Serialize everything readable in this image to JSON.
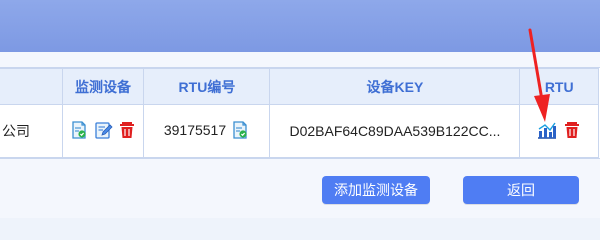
{
  "table": {
    "headers": {
      "monitor_device": "监测设备",
      "rtu_code": "RTU编号",
      "device_key": "设备KEY",
      "rtu": "RTU"
    },
    "row": {
      "company_fragment": "公司",
      "rtu_code": "39175517",
      "device_key": "D02BAF64C89DAA539B122CC..."
    }
  },
  "buttons": {
    "add_device": "添加监测设备",
    "back": "返回"
  },
  "colors": {
    "header_bar": "#7d99e3",
    "table_header_bg": "#e6eefb",
    "header_text": "#3f6fd4",
    "button_bg": "#4f7df3",
    "delete_icon": "#e02020",
    "arrow": "#ee2222"
  }
}
